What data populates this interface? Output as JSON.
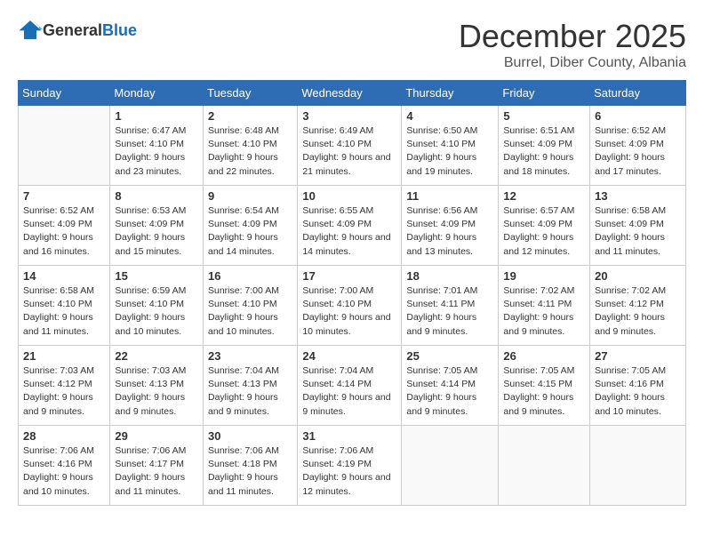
{
  "header": {
    "logo_general": "General",
    "logo_blue": "Blue",
    "month_title": "December 2025",
    "subtitle": "Burrel, Diber County, Albania"
  },
  "weekdays": [
    "Sunday",
    "Monday",
    "Tuesday",
    "Wednesday",
    "Thursday",
    "Friday",
    "Saturday"
  ],
  "weeks": [
    [
      {
        "day": "",
        "sunrise": "",
        "sunset": "",
        "daylight": ""
      },
      {
        "day": "1",
        "sunrise": "6:47 AM",
        "sunset": "4:10 PM",
        "daylight": "9 hours and 23 minutes."
      },
      {
        "day": "2",
        "sunrise": "6:48 AM",
        "sunset": "4:10 PM",
        "daylight": "9 hours and 22 minutes."
      },
      {
        "day": "3",
        "sunrise": "6:49 AM",
        "sunset": "4:10 PM",
        "daylight": "9 hours and 21 minutes."
      },
      {
        "day": "4",
        "sunrise": "6:50 AM",
        "sunset": "4:10 PM",
        "daylight": "9 hours and 19 minutes."
      },
      {
        "day": "5",
        "sunrise": "6:51 AM",
        "sunset": "4:09 PM",
        "daylight": "9 hours and 18 minutes."
      },
      {
        "day": "6",
        "sunrise": "6:52 AM",
        "sunset": "4:09 PM",
        "daylight": "9 hours and 17 minutes."
      }
    ],
    [
      {
        "day": "7",
        "sunrise": "6:52 AM",
        "sunset": "4:09 PM",
        "daylight": "9 hours and 16 minutes."
      },
      {
        "day": "8",
        "sunrise": "6:53 AM",
        "sunset": "4:09 PM",
        "daylight": "9 hours and 15 minutes."
      },
      {
        "day": "9",
        "sunrise": "6:54 AM",
        "sunset": "4:09 PM",
        "daylight": "9 hours and 14 minutes."
      },
      {
        "day": "10",
        "sunrise": "6:55 AM",
        "sunset": "4:09 PM",
        "daylight": "9 hours and 14 minutes."
      },
      {
        "day": "11",
        "sunrise": "6:56 AM",
        "sunset": "4:09 PM",
        "daylight": "9 hours and 13 minutes."
      },
      {
        "day": "12",
        "sunrise": "6:57 AM",
        "sunset": "4:09 PM",
        "daylight": "9 hours and 12 minutes."
      },
      {
        "day": "13",
        "sunrise": "6:58 AM",
        "sunset": "4:09 PM",
        "daylight": "9 hours and 11 minutes."
      }
    ],
    [
      {
        "day": "14",
        "sunrise": "6:58 AM",
        "sunset": "4:10 PM",
        "daylight": "9 hours and 11 minutes."
      },
      {
        "day": "15",
        "sunrise": "6:59 AM",
        "sunset": "4:10 PM",
        "daylight": "9 hours and 10 minutes."
      },
      {
        "day": "16",
        "sunrise": "7:00 AM",
        "sunset": "4:10 PM",
        "daylight": "9 hours and 10 minutes."
      },
      {
        "day": "17",
        "sunrise": "7:00 AM",
        "sunset": "4:10 PM",
        "daylight": "9 hours and 10 minutes."
      },
      {
        "day": "18",
        "sunrise": "7:01 AM",
        "sunset": "4:11 PM",
        "daylight": "9 hours and 9 minutes."
      },
      {
        "day": "19",
        "sunrise": "7:02 AM",
        "sunset": "4:11 PM",
        "daylight": "9 hours and 9 minutes."
      },
      {
        "day": "20",
        "sunrise": "7:02 AM",
        "sunset": "4:12 PM",
        "daylight": "9 hours and 9 minutes."
      }
    ],
    [
      {
        "day": "21",
        "sunrise": "7:03 AM",
        "sunset": "4:12 PM",
        "daylight": "9 hours and 9 minutes."
      },
      {
        "day": "22",
        "sunrise": "7:03 AM",
        "sunset": "4:13 PM",
        "daylight": "9 hours and 9 minutes."
      },
      {
        "day": "23",
        "sunrise": "7:04 AM",
        "sunset": "4:13 PM",
        "daylight": "9 hours and 9 minutes."
      },
      {
        "day": "24",
        "sunrise": "7:04 AM",
        "sunset": "4:14 PM",
        "daylight": "9 hours and 9 minutes."
      },
      {
        "day": "25",
        "sunrise": "7:05 AM",
        "sunset": "4:14 PM",
        "daylight": "9 hours and 9 minutes."
      },
      {
        "day": "26",
        "sunrise": "7:05 AM",
        "sunset": "4:15 PM",
        "daylight": "9 hours and 9 minutes."
      },
      {
        "day": "27",
        "sunrise": "7:05 AM",
        "sunset": "4:16 PM",
        "daylight": "9 hours and 10 minutes."
      }
    ],
    [
      {
        "day": "28",
        "sunrise": "7:06 AM",
        "sunset": "4:16 PM",
        "daylight": "9 hours and 10 minutes."
      },
      {
        "day": "29",
        "sunrise": "7:06 AM",
        "sunset": "4:17 PM",
        "daylight": "9 hours and 11 minutes."
      },
      {
        "day": "30",
        "sunrise": "7:06 AM",
        "sunset": "4:18 PM",
        "daylight": "9 hours and 11 minutes."
      },
      {
        "day": "31",
        "sunrise": "7:06 AM",
        "sunset": "4:19 PM",
        "daylight": "9 hours and 12 minutes."
      },
      {
        "day": "",
        "sunrise": "",
        "sunset": "",
        "daylight": ""
      },
      {
        "day": "",
        "sunrise": "",
        "sunset": "",
        "daylight": ""
      },
      {
        "day": "",
        "sunrise": "",
        "sunset": "",
        "daylight": ""
      }
    ]
  ],
  "labels": {
    "sunrise_prefix": "Sunrise: ",
    "sunset_prefix": "Sunset: ",
    "daylight_prefix": "Daylight: "
  }
}
